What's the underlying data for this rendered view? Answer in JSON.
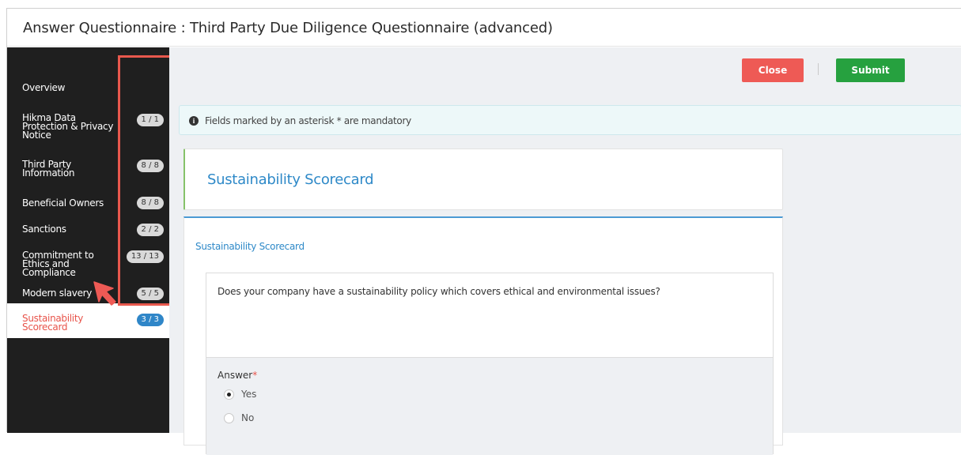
{
  "window": {
    "title": "Answer Questionnaire : Third Party Due Diligence Questionnaire (advanced)"
  },
  "sidebar": {
    "items": [
      {
        "label": "Overview",
        "badge": ""
      },
      {
        "label": "Hikma Data Protection & Privacy Notice",
        "badge": "1 / 1"
      },
      {
        "label": "Third Party Information",
        "badge": "8 / 8"
      },
      {
        "label": "Beneficial Owners",
        "badge": "8 / 8"
      },
      {
        "label": "Sanctions",
        "badge": "2 / 2"
      },
      {
        "label": "Commitment to Ethics and Compliance",
        "badge": "13 / 13"
      },
      {
        "label": "Modern slavery",
        "badge": "5 / 5"
      },
      {
        "label": "Sustainability Scorecard",
        "badge": "3 / 3",
        "active": true
      }
    ]
  },
  "toolbar": {
    "close_label": "Close",
    "submit_label": "Submit"
  },
  "info": {
    "text": "Fields marked by an asterisk * are mandatory"
  },
  "section": {
    "title": "Sustainability Scorecard"
  },
  "card": {
    "title": "Sustainability Scorecard",
    "question": "Does your company have a sustainability policy which covers ethical and environmental issues?",
    "answer_label": "Answer",
    "required_mark": "*",
    "options": [
      {
        "label": "Yes",
        "checked": true
      },
      {
        "label": "No",
        "checked": false
      }
    ]
  },
  "colors": {
    "accent": "#2e89c8",
    "close": "#ee5a55",
    "submit": "#26a13f",
    "highlight": "#e8584d",
    "sidebar_bg": "#1f1f1f"
  },
  "icons": {
    "info": "info-icon",
    "cursor": "cursor-arrow-icon"
  }
}
